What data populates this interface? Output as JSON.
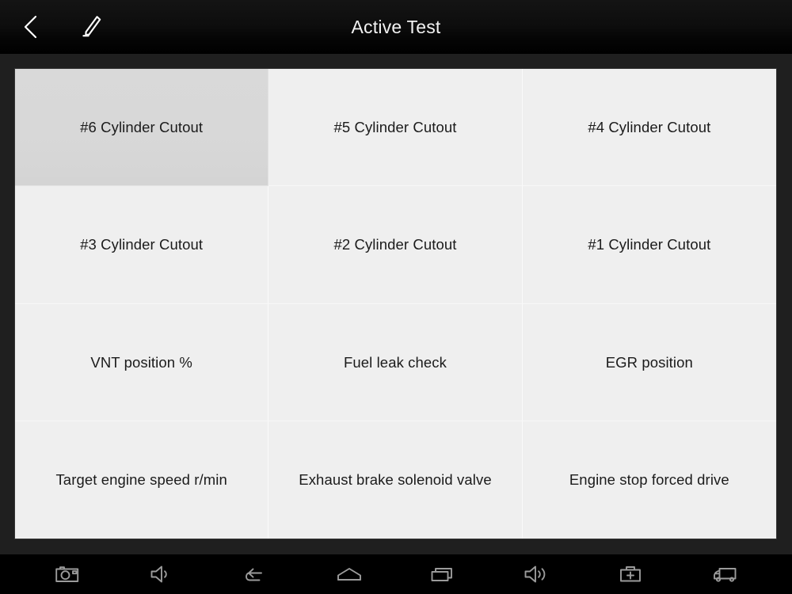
{
  "header": {
    "title": "Active Test",
    "back_icon": "chevron-left-icon",
    "edit_icon": "pencil-icon"
  },
  "grid": {
    "selected_index": 0,
    "colors": {
      "cell_background": "#efefef",
      "cell_selected_background": "#d8d8d8",
      "frame_background": "#1f1f1f",
      "text": "#1b1b1b",
      "header_text": "#f2f2f2",
      "nav_icon": "#9b9b9b"
    },
    "items": [
      {
        "label": "#6 Cylinder Cutout",
        "selected": true
      },
      {
        "label": "#5 Cylinder Cutout",
        "selected": false
      },
      {
        "label": "#4 Cylinder Cutout",
        "selected": false
      },
      {
        "label": "#3 Cylinder Cutout",
        "selected": false
      },
      {
        "label": "#2 Cylinder Cutout",
        "selected": false
      },
      {
        "label": "#1 Cylinder Cutout",
        "selected": false
      },
      {
        "label": "VNT position %",
        "selected": false
      },
      {
        "label": "Fuel leak check",
        "selected": false
      },
      {
        "label": "EGR position",
        "selected": false
      },
      {
        "label": "Target engine speed r/min",
        "selected": false
      },
      {
        "label": "Exhaust brake solenoid valve",
        "selected": false
      },
      {
        "label": "Engine stop forced drive",
        "selected": false
      }
    ]
  },
  "navbar": {
    "items": [
      {
        "name": "camera-icon",
        "label": "Screenshot"
      },
      {
        "name": "volume-down-icon",
        "label": "Volume down"
      },
      {
        "name": "back-arrow-icon",
        "label": "Back"
      },
      {
        "name": "home-icon",
        "label": "Home"
      },
      {
        "name": "recent-apps-icon",
        "label": "Recent apps"
      },
      {
        "name": "volume-up-icon",
        "label": "Volume up"
      },
      {
        "name": "toolbox-icon",
        "label": "Diagnostics toolbox"
      },
      {
        "name": "truck-icon",
        "label": "Vehicle"
      }
    ]
  }
}
